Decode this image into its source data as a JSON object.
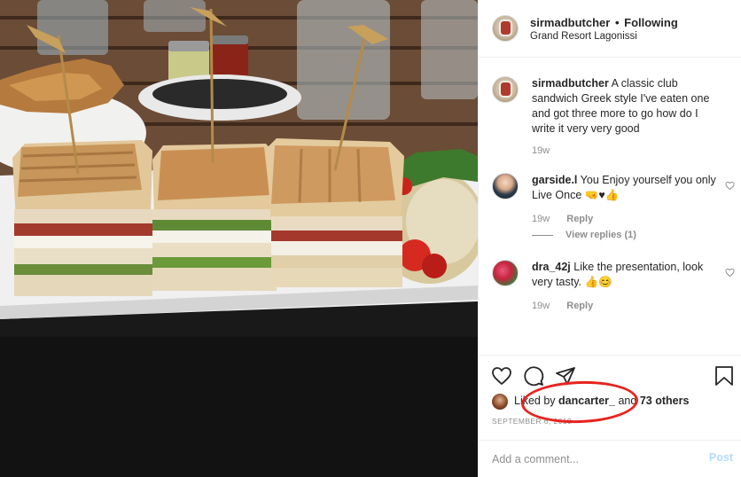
{
  "post": {
    "username": "sirmadbutcher",
    "separator": "•",
    "follow_status": "Following",
    "location": "Grand Resort Lagonissi",
    "caption": "A classic club sandwich Greek style I've eaten one and got three more to go how do I write it very very good",
    "caption_age": "19w"
  },
  "comments": [
    {
      "username": "garside.l",
      "text": "You Enjoy yourself you only Live Once 🤜♥👍",
      "age": "19w",
      "reply_label": "Reply",
      "view_replies": "View replies (1)"
    },
    {
      "username": "dra_42j",
      "text": "Like the presentation, look very tasty. 👍😊",
      "age": "19w",
      "reply_label": "Reply"
    }
  ],
  "likes": {
    "prefix": "Liked by",
    "liker": "dancarter_",
    "conjunction": "and",
    "others": "73 others"
  },
  "date": "SEPTEMBER 6, 2019",
  "add_comment": {
    "placeholder": "Add a comment...",
    "post_label": "Post"
  },
  "icons": [
    "heart-icon",
    "comment-icon",
    "share-icon",
    "bookmark-icon",
    "small-heart-icon"
  ],
  "colors": {
    "annotation_circle": "#e8231f",
    "post_button_disabled": "#b3dbff",
    "meta_gray": "#8e8e8e"
  }
}
